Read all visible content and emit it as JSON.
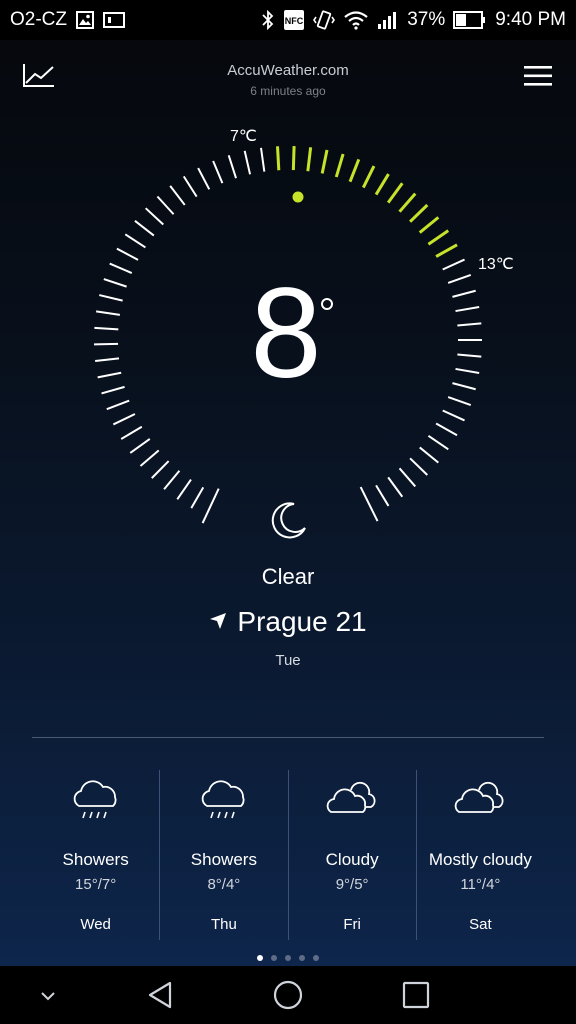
{
  "status_bar": {
    "carrier": "O2-CZ",
    "battery": "37%",
    "time": "9:40 PM",
    "icons": [
      "image-icon",
      "notification-icon",
      "bluetooth-icon",
      "nfc-icon",
      "vibrate-icon",
      "wifi-icon",
      "signal-icon",
      "battery-icon"
    ]
  },
  "header": {
    "title": "AccuWeather.com",
    "subtitle": "6 minutes ago",
    "left_icon": "trend-chart-icon",
    "right_icon": "menu-icon"
  },
  "current": {
    "temperature": "8",
    "low_label": "7℃",
    "high_label": "13℃",
    "condition": "Clear",
    "location": "Prague 21",
    "day": "Tue",
    "accent_color": "#c6e32a"
  },
  "forecast": [
    {
      "condition": "Showers",
      "range": "15°/7°",
      "day": "Wed",
      "icon": "rain-cloud-icon"
    },
    {
      "condition": "Showers",
      "range": "8°/4°",
      "day": "Thu",
      "icon": "rain-cloud-icon"
    },
    {
      "condition": "Cloudy",
      "range": "9°/5°",
      "day": "Fri",
      "icon": "cloudy-icon"
    },
    {
      "condition": "Mostly cloudy",
      "range": "11°/4°",
      "day": "Sat",
      "icon": "cloudy-icon"
    }
  ],
  "pager": {
    "count": 5,
    "active": 0
  }
}
